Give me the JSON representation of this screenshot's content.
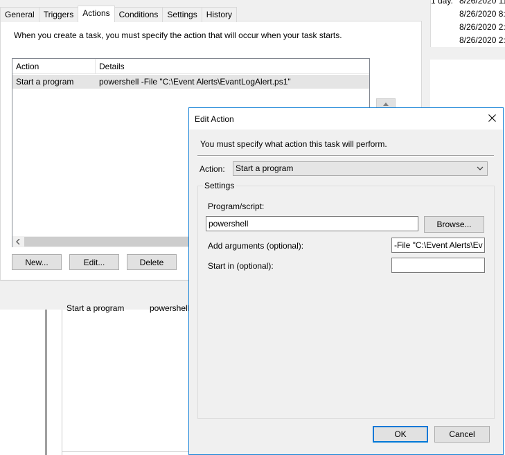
{
  "background": {
    "right_strip": {
      "partial_text": "1 day.",
      "dates": [
        "8/26/2020 11",
        "8/26/2020 8:",
        "8/26/2020 2:",
        "8/26/2020 2:"
      ]
    },
    "lower_row": {
      "action": "Start a program",
      "details": "powershell"
    }
  },
  "task_properties": {
    "tabs": [
      {
        "label": "General"
      },
      {
        "label": "Triggers"
      },
      {
        "label": "Actions"
      },
      {
        "label": "Conditions"
      },
      {
        "label": "Settings"
      },
      {
        "label": "History"
      }
    ],
    "active_tab": "Actions",
    "intro": "When you create a task, you must specify the action that will occur when your task starts.",
    "list": {
      "columns": [
        "Action",
        "Details"
      ],
      "rows": [
        {
          "action": "Start a program",
          "details": "powershell -File  \"C:\\Event Alerts\\EvantLogAlert.ps1\""
        }
      ]
    },
    "buttons": {
      "new": "New...",
      "edit": "Edit...",
      "delete": "Delete"
    }
  },
  "edit_action": {
    "title": "Edit Action",
    "message": "You must specify what action this task will perform.",
    "action_label": "Action:",
    "action_value": "Start a program",
    "settings_label": "Settings",
    "program_label": "Program/script:",
    "program_value": "powershell",
    "browse": "Browse...",
    "args_label": "Add arguments (optional):",
    "args_value": "-File  \"C:\\Event Alerts\\Ev",
    "startin_label": "Start in (optional):",
    "startin_value": "",
    "ok": "OK",
    "cancel": "Cancel"
  },
  "icons": {
    "close": "close-icon",
    "dropdown": "chevron-down-icon",
    "scroll_left": "chevron-left-icon",
    "scroll_up": "chevron-up-icon"
  },
  "colors": {
    "dialog_border": "#1883d7",
    "selection_row": "#e5e5e5",
    "ok_border": "#0078d7",
    "window_bg": "#f0f0f0"
  }
}
